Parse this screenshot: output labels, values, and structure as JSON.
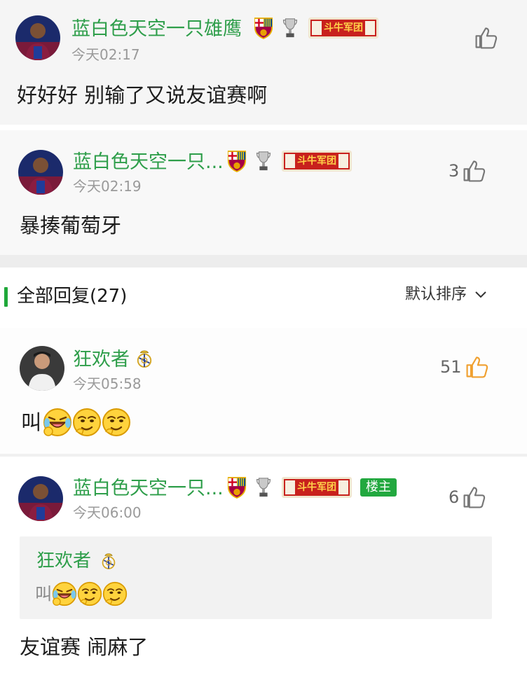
{
  "comments": [
    {
      "author": "蓝白色天空一只雄鹰",
      "time": "今天02:17",
      "text": "好好好 别输了又说友谊赛啊",
      "likes": ""
    },
    {
      "author": "蓝白色天空一只...",
      "time": "今天02:19",
      "text": "暴揍葡萄牙",
      "likes": "3"
    }
  ],
  "replies_header": {
    "title": "全部回复(27)",
    "sort_label": "默认排序"
  },
  "replies": [
    {
      "author": "狂欢者",
      "time": "今天05:58",
      "text": "叫",
      "likes": "51"
    },
    {
      "author": "蓝白色天空一只...",
      "owner_badge": "楼主",
      "time": "今天06:00",
      "likes": "6",
      "quote": {
        "author": "狂欢者",
        "text": "叫"
      },
      "text": "友谊赛 闹麻了"
    }
  ],
  "badges": {
    "scarf_text": "斗牛军团"
  },
  "colors": {
    "name_green": "#2e9e4a",
    "accent_green": "#1fa83a",
    "liked_orange": "#f0a030"
  },
  "icons": [
    "thumbs-up-icon",
    "chevron-down-icon",
    "barcelona-crest-icon",
    "trophy-icon",
    "real-madrid-crest-icon",
    "laughing-emoji",
    "smirk-emoji"
  ]
}
